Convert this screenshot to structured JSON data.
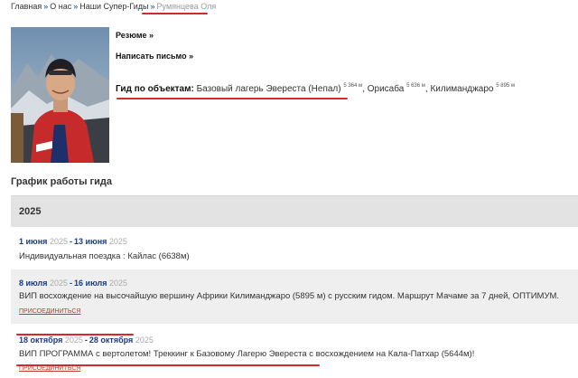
{
  "breadcrumb": {
    "items": [
      "Главная",
      "О нас",
      "Наши Супер-Гиды"
    ],
    "current": "Румянцева Оля"
  },
  "profile": {
    "resume_label": "Резюме »",
    "write_label": "Написать письмо »",
    "guide_label": "Гид по объектам:",
    "objects": [
      {
        "name": "Базовый лагерь Эвереста (Непал)",
        "height": "5 364 м"
      },
      {
        "name": "Орисаба",
        "height": "5 636 м"
      },
      {
        "name": "Килиманджаро",
        "height": "5 895 м"
      }
    ]
  },
  "schedule": {
    "title": "График работы гида",
    "year": "2025",
    "events": [
      {
        "start_day": "1 июня",
        "start_year": "2025",
        "end_day": "13 июня",
        "end_year": "2025",
        "title": "Индивидуальная поездка : Кайлас (6638м)",
        "join": ""
      },
      {
        "start_day": "8 июля",
        "start_year": "2025",
        "end_day": "16 июля",
        "end_year": "2025",
        "title": "ВИП восхождение на высочайшую вершину Африки Килиманджаро (5895 м) с русским гидом. Маршрут Мачаме за 7 дней, ОПТИМУМ.",
        "join": "ПРИСОЕДИНИТЬСЯ"
      },
      {
        "start_day": "18 октября",
        "start_year": "2025",
        "end_day": "28 октября",
        "end_year": "2025",
        "title": "ВИП ПРОГРАММА с вертолетом! Треккинг к Базовому Лагерю Эвереста с восхождением на Кала-Патхар (5644м)!",
        "join": "ПРИСОЕДИНИТЬСЯ"
      }
    ]
  },
  "colors": {
    "accent_red": "#d42a2a",
    "link_blue": "#1a3a8a",
    "row_alt": "#efefef",
    "year_bar": "#e3e3e3"
  }
}
